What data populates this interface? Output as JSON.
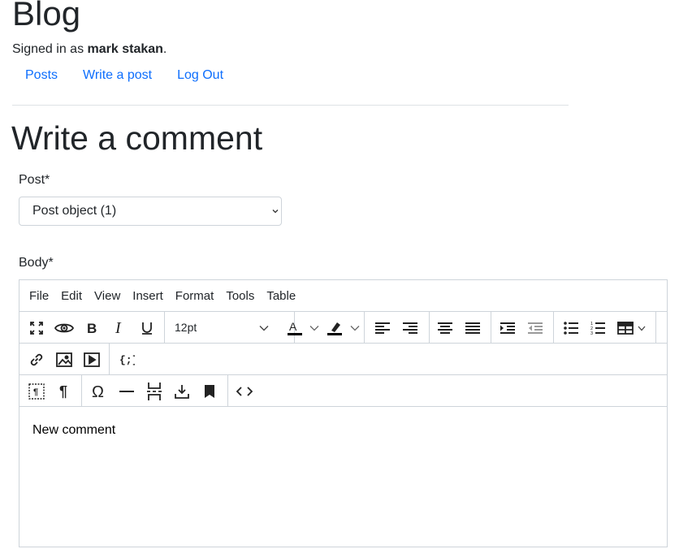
{
  "site": {
    "title": "Blog"
  },
  "user": {
    "signed_in_prefix": "Signed in as ",
    "name": "mark stakan",
    "signed_in_suffix": "."
  },
  "nav": {
    "posts": "Posts",
    "write": "Write a post",
    "logout": "Log Out"
  },
  "page": {
    "title": "Write a comment"
  },
  "form": {
    "post_label": "Post*",
    "post_selected": "Post object (1)",
    "body_label": "Body*"
  },
  "editor": {
    "menu": {
      "file": "File",
      "edit": "Edit",
      "view": "View",
      "insert": "Insert",
      "format": "Format",
      "tools": "Tools",
      "table": "Table"
    },
    "font_size": "12pt",
    "content": "New comment",
    "colors": {
      "text_color": "#000000",
      "highlight": "#000000"
    }
  }
}
